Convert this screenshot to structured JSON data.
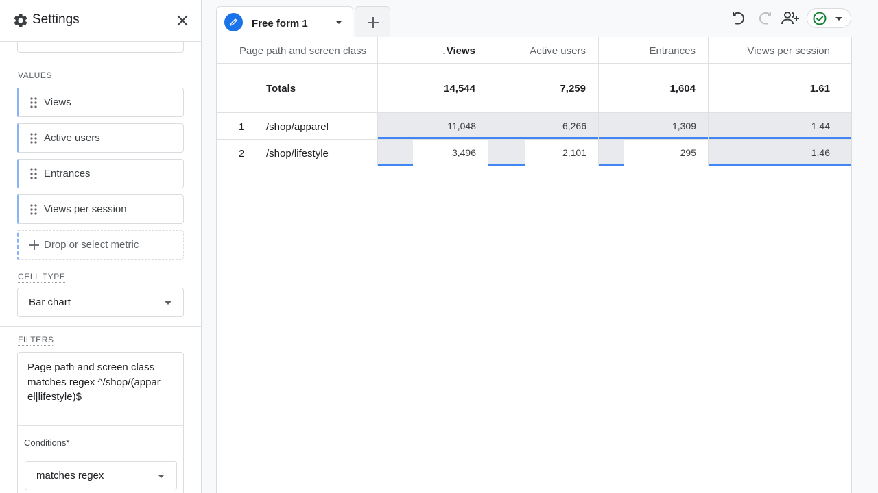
{
  "panel": {
    "title": "Settings",
    "values_label": "VALUES",
    "metrics": [
      {
        "label": "Views"
      },
      {
        "label": "Active users"
      },
      {
        "label": "Entrances"
      },
      {
        "label": "Views per session"
      }
    ],
    "drop_metric_label": "Drop or select metric",
    "cell_type_label": "CELL TYPE",
    "cell_type_value": "Bar chart",
    "filters_label": "FILTERS",
    "filter_text": "Page path and screen class matches regex ^/shop/(apparel|lifestyle)$",
    "conditions_label": "Conditions*",
    "conditions_value": "matches regex"
  },
  "tabs": [
    {
      "label": "Free form 1"
    }
  ],
  "toolbar": {
    "icons": [
      "undo-icon",
      "redo-icon",
      "share-icon",
      "check-circle-icon"
    ],
    "accent": "#1a73e8",
    "check_color": "#188038"
  },
  "table": {
    "columns": [
      {
        "label": "Page path and screen class"
      },
      {
        "label": "Views",
        "sort": "↓"
      },
      {
        "label": "Active users"
      },
      {
        "label": "Entrances"
      },
      {
        "label": "Views per session"
      }
    ],
    "totals": {
      "label": "Totals",
      "values": [
        "14,544",
        "7,259",
        "1,604",
        "1.61"
      ]
    },
    "rows": [
      {
        "num": "1",
        "dim": "/shop/apparel",
        "values": [
          "11,048",
          "6,266",
          "1,309",
          "1.44"
        ],
        "fractions": [
          1.0,
          1.0,
          1.0,
          0.986
        ]
      },
      {
        "num": "2",
        "dim": "/shop/lifestyle",
        "values": [
          "3,496",
          "2,101",
          "295",
          "1.46"
        ],
        "fractions": [
          0.316,
          0.335,
          0.225,
          1.0
        ]
      }
    ],
    "bar_color": "#4285f4",
    "bar_bg_color": "#e8eaed"
  }
}
